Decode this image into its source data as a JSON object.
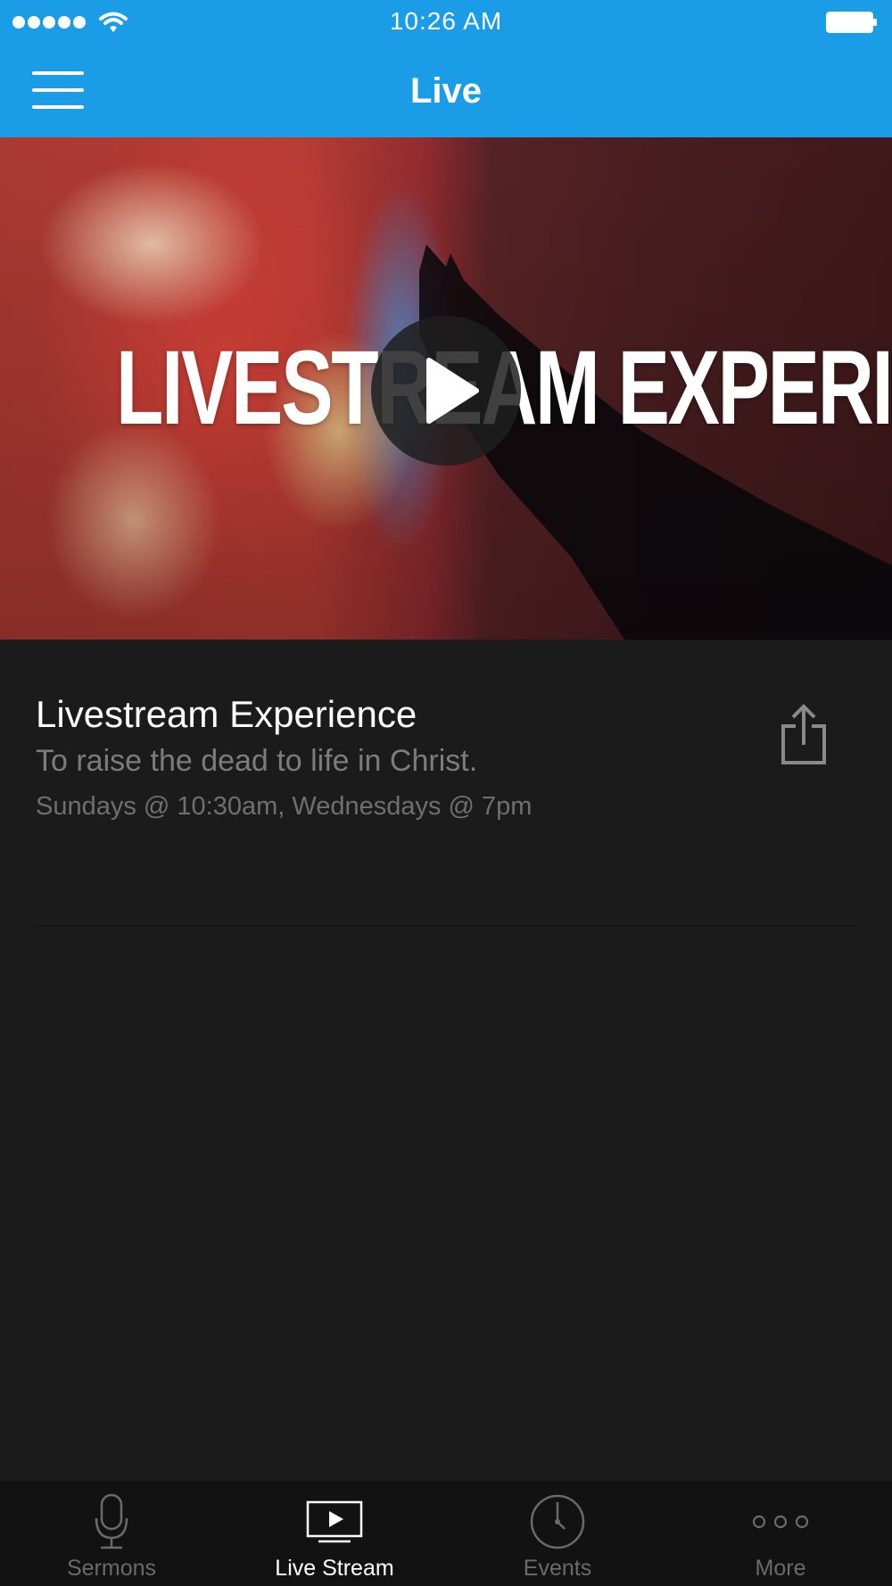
{
  "status_bar": {
    "time": "10:26 AM",
    "signal_icon": "signal-dots-icon",
    "wifi_icon": "wifi-icon",
    "battery_icon": "battery-icon"
  },
  "nav": {
    "title": "Live",
    "menu_icon": "hamburger-menu-icon"
  },
  "hero": {
    "overlay_text": "LIVESTREAM EXPERIENCE",
    "play_icon": "play-icon"
  },
  "stream": {
    "title": "Livestream Experience",
    "subtitle": "To raise the dead to life in Christ.",
    "schedule": "Sundays @ 10:30am, Wednesdays @ 7pm",
    "share_icon": "share-icon"
  },
  "tabs": [
    {
      "label": "Sermons",
      "icon": "microphone-icon",
      "active": false
    },
    {
      "label": "Live Stream",
      "icon": "tv-play-icon",
      "active": true
    },
    {
      "label": "Events",
      "icon": "clock-icon",
      "active": false
    },
    {
      "label": "More",
      "icon": "more-dots-icon",
      "active": false
    }
  ],
  "colors": {
    "header_blue": "#1a9de6",
    "background": "#1b1b1b",
    "tab_bar": "#121212",
    "inactive_gray": "#6a6a6a"
  }
}
